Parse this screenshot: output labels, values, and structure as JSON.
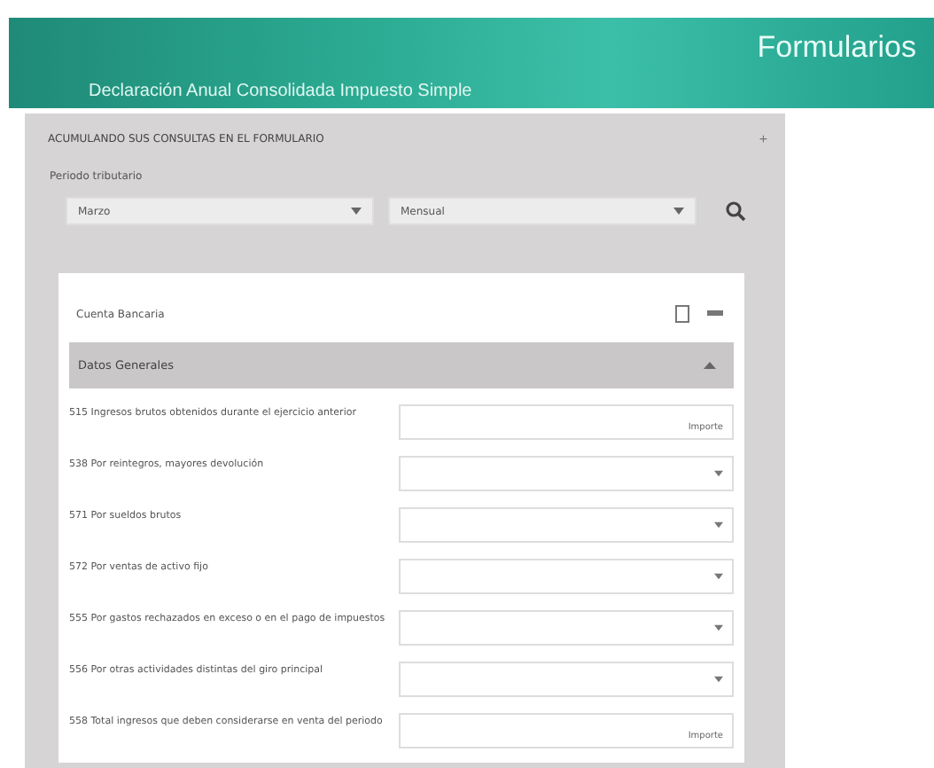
{
  "banner": {
    "title": "Formularios",
    "subtitle": "Declaración Anual Consolidada Impuesto Simple"
  },
  "panel": {
    "title": "ACUMULANDO SUS CONSULTAS EN EL FORMULARIO",
    "expand": "+",
    "filter_label": "Periodo tributario",
    "selects": [
      {
        "value": "Marzo"
      },
      {
        "value": "Mensual"
      }
    ]
  },
  "card": {
    "title": "Cuenta Bancaria",
    "section": {
      "title": "Datos Generales",
      "expanded": true
    },
    "rows": [
      {
        "kind": "text",
        "label": "515 Ingresos brutos obtenidos durante el ejercicio anterior",
        "value": "Importe"
      },
      {
        "kind": "select",
        "label": "538 Por reintegros, mayores devolución"
      },
      {
        "kind": "select",
        "label": "571 Por sueldos brutos"
      },
      {
        "kind": "select",
        "label": "572 Por ventas de activo fijo"
      },
      {
        "kind": "select",
        "label": "555 Por gastos rechazados en exceso o en el pago de impuestos"
      },
      {
        "kind": "select",
        "label": "556 Por otras actividades distintas del giro principal"
      },
      {
        "kind": "text",
        "label": "558 Total ingresos que deben considerarse en venta del periodo",
        "value": "Importe"
      }
    ]
  }
}
